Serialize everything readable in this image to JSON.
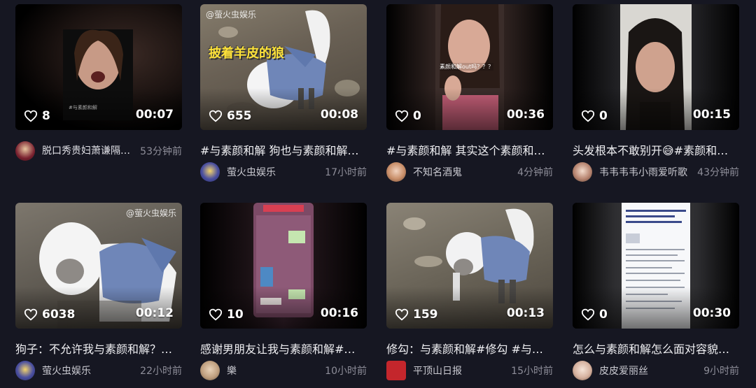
{
  "videos": [
    {
      "likes": "8",
      "duration": "00:07",
      "title": "脱口秀贵妇萧谦隔…",
      "author": "",
      "time": "53分钟前",
      "inline_title": true,
      "colors": {
        "bg": "#100c0c",
        "subject": "#c79a86",
        "avatar": "#7a2230"
      }
    },
    {
      "likes": "655",
      "duration": "00:08",
      "title": "#与素颜和解 狗也与素颜和解…",
      "author": "萤火虫娱乐",
      "time": "17小时前",
      "overlay": "披着羊皮的狼",
      "watermark": "@萤火虫娱乐",
      "colors": {
        "bg": "#6d6558",
        "subject": "#eef0f2",
        "avatar": "#4a4fa0"
      }
    },
    {
      "likes": "0",
      "duration": "00:36",
      "title": "#与素颜和解 其实这个素颜和…",
      "author": "不知名酒鬼",
      "time": "4分钟前",
      "overlay_small": "素颜和解out吗？？？",
      "colors": {
        "bg": "#3a2724",
        "subject": "#d8a996",
        "avatar": "#c98f6a"
      }
    },
    {
      "likes": "0",
      "duration": "00:15",
      "title": "头发根本不敢别开😅#素颜和…",
      "author": "韦韦韦韦小雨爱听歌",
      "time": "43分钟前",
      "colors": {
        "bg": "#2a2a2e",
        "subject": "#cfa28e",
        "avatar": "#b88672"
      }
    },
    {
      "likes": "6038",
      "duration": "00:12",
      "title": "狗子：不允许我与素颜和解？…",
      "author": "萤火虫娱乐",
      "time": "22小时前",
      "watermark": "@萤火虫娱乐",
      "colors": {
        "bg": "#5d5a55",
        "subject": "#f4f4f4",
        "avatar": "#4a4fa0"
      }
    },
    {
      "likes": "10",
      "duration": "00:16",
      "title": "感谢男朋友让我与素颜和解#…",
      "author": "樂",
      "time": "10小时前",
      "colors": {
        "bg": "#1a0f12",
        "subject": "#8a5a78",
        "avatar": "#c0a080"
      }
    },
    {
      "likes": "159",
      "duration": "00:13",
      "title": "修勾：与素颜和解#修勾 #与…",
      "author": "平顶山日报",
      "time": "15小时前",
      "colors": {
        "bg": "#6a6458",
        "subject": "#eceef0",
        "avatar": "#c4262c"
      }
    },
    {
      "likes": "0",
      "duration": "00:30",
      "title": "怎么与素颜和解怎么面对容貌…",
      "author": "皮皮爱丽丝",
      "time": "9小时前",
      "colors": {
        "bg": "#2d2d30",
        "subject": "#f2f4f8",
        "avatar": "#d6b2a0"
      }
    }
  ]
}
